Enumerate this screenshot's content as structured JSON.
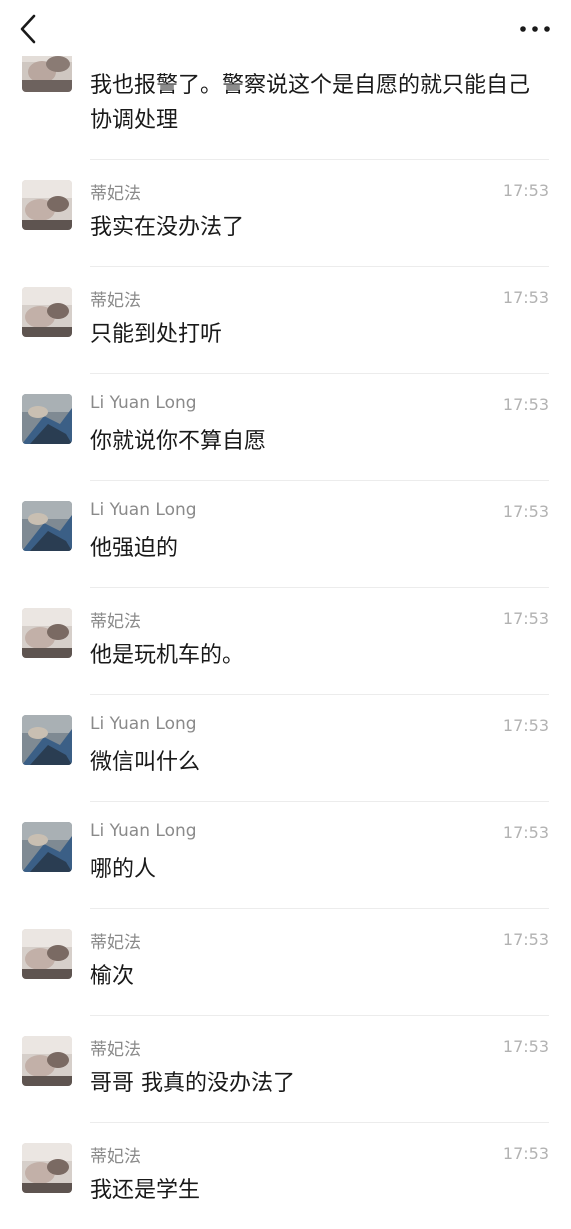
{
  "header": {
    "back_icon": "chevron-left-icon",
    "more_icon": "more-dots-icon"
  },
  "first_message": {
    "text": "我也报警了。警察说这个是自愿的就只能自己协调处理"
  },
  "messages": [
    {
      "sender": "蒂妃法",
      "time": "17:53",
      "text": "我实在没办法了",
      "avatar": "a"
    },
    {
      "sender": "蒂妃法",
      "time": "17:53",
      "text": "只能到处打听",
      "avatar": "a"
    },
    {
      "sender": "Li Yuan Long",
      "time": "17:53",
      "text": "你就说你不算自愿",
      "avatar": "b"
    },
    {
      "sender": "Li Yuan Long",
      "time": "17:53",
      "text": "他强迫的",
      "avatar": "b"
    },
    {
      "sender": "蒂妃法",
      "time": "17:53",
      "text": "他是玩机车的。",
      "avatar": "a"
    },
    {
      "sender": "Li Yuan Long",
      "time": "17:53",
      "text": "微信叫什么",
      "avatar": "b"
    },
    {
      "sender": "Li Yuan Long",
      "time": "17:53",
      "text": "哪的人",
      "avatar": "b"
    },
    {
      "sender": "蒂妃法",
      "time": "17:53",
      "text": "榆次",
      "avatar": "a"
    },
    {
      "sender": "蒂妃法",
      "time": "17:53",
      "text": "哥哥 我真的没办法了",
      "avatar": "a"
    },
    {
      "sender": "蒂妃法",
      "time": "17:53",
      "text": "我还是学生",
      "avatar": "a"
    }
  ]
}
